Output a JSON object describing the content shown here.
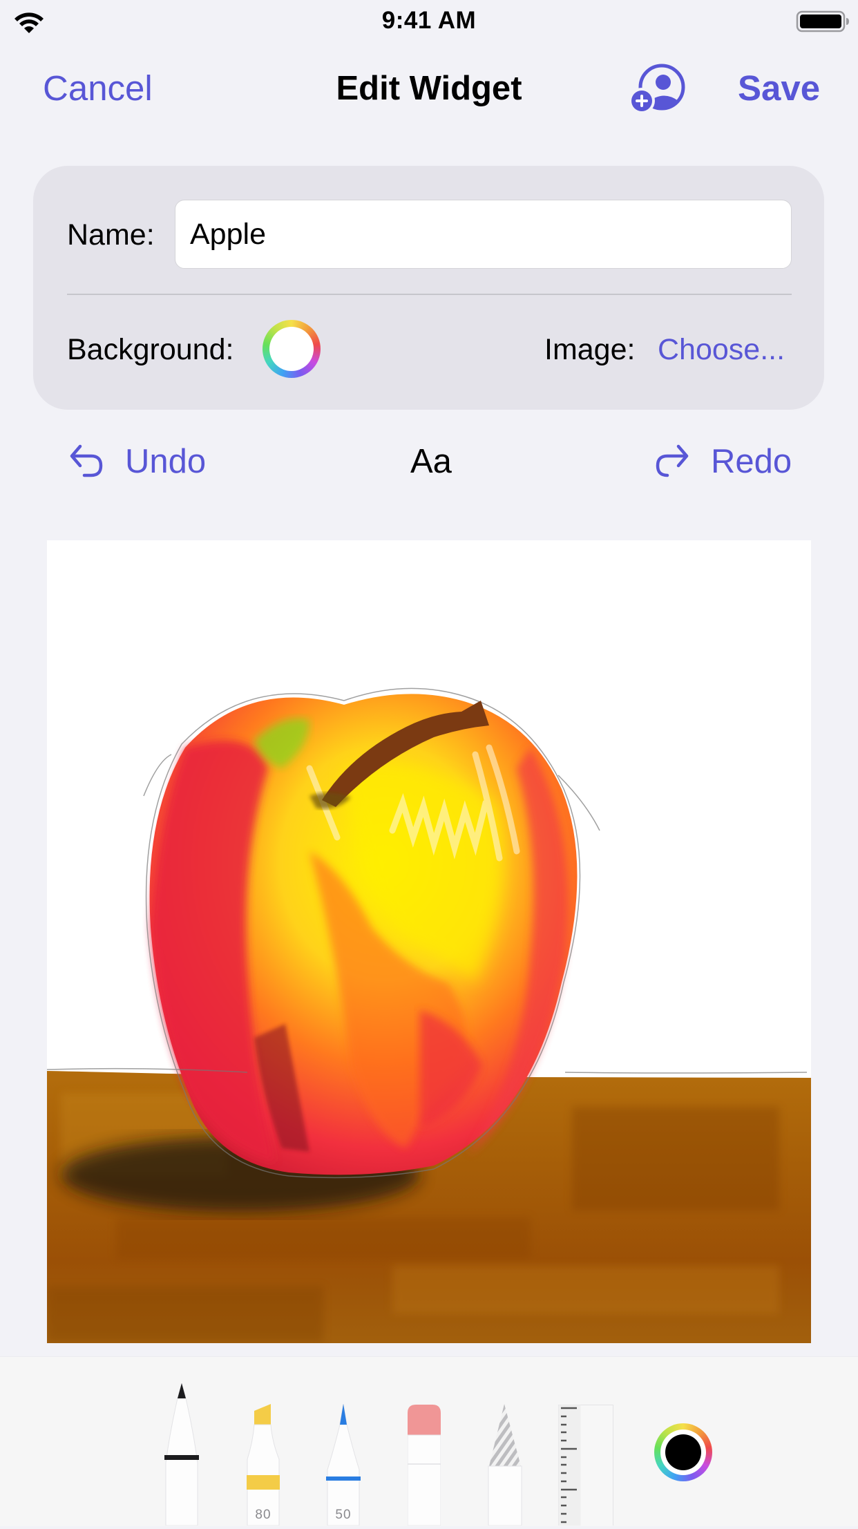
{
  "status_bar": {
    "time": "9:41 AM",
    "wifi_icon": "wifi-icon",
    "battery_icon": "battery-full-icon"
  },
  "nav": {
    "cancel_label": "Cancel",
    "title": "Edit Widget",
    "share_icon": "person-add-icon",
    "save_label": "Save"
  },
  "form": {
    "name_label": "Name:",
    "name_value": "Apple",
    "background_label": "Background:",
    "background_color": "#ffffff",
    "image_label": "Image:",
    "choose_label": "Choose..."
  },
  "edit_bar": {
    "undo_label": "Undo",
    "text_tool_label": "Aa",
    "redo_label": "Redo"
  },
  "canvas": {
    "content": "hand-drawn apple on wooden table",
    "icon": "drawing-canvas"
  },
  "tool_palette": {
    "tools": [
      {
        "name": "pen",
        "color": "#1c1c1e"
      },
      {
        "name": "marker",
        "color": "#f4cc47",
        "value": "80"
      },
      {
        "name": "pencil",
        "color": "#2a7de1",
        "value": "50"
      },
      {
        "name": "eraser",
        "color": "#f09696"
      },
      {
        "name": "lasso"
      },
      {
        "name": "ruler"
      }
    ],
    "current_color": "#000000"
  },
  "colors": {
    "accent": "#5856d6",
    "background": "#f2f2f7",
    "card": "#e4e3ea",
    "palette": "#f6f6f6"
  }
}
